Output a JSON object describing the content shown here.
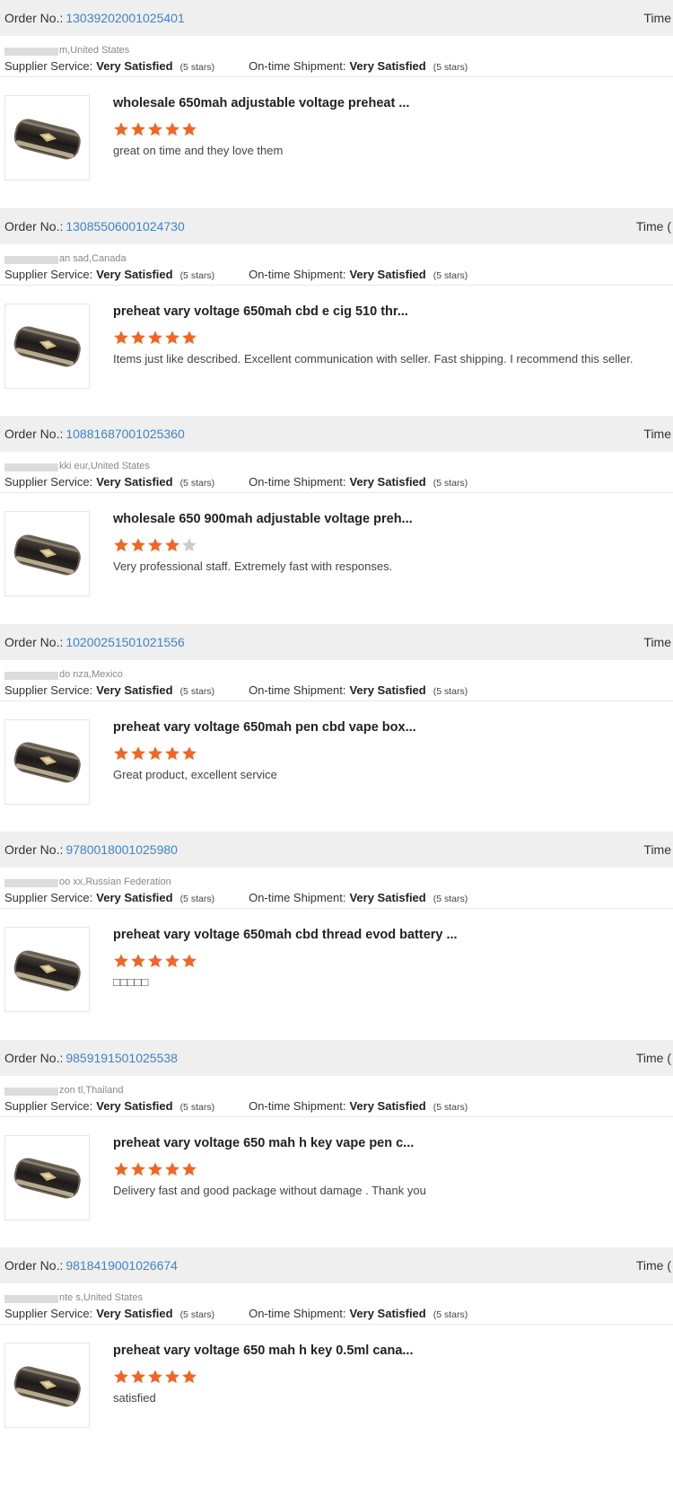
{
  "labels": {
    "order_no": "Order No.:",
    "time": "Time",
    "supplier_service": "Supplier Service:",
    "on_time_shipment": "On-time Shipment:"
  },
  "colors": {
    "accent_link": "#3d85c6",
    "star_filled": "#f26522",
    "star_empty": "#cccccc",
    "header_bg": "#efefef"
  },
  "orders": [
    {
      "order_no": "13039202001025401",
      "time": "Time",
      "buyer_location": "m,United States",
      "supplier_service": "Very Satisfied",
      "supplier_stars": "(5 stars)",
      "shipment": "Very Satisfied",
      "shipment_stars": "(5 stars)",
      "product_title": "wholesale 650mah adjustable voltage preheat ...",
      "rating": 5,
      "comment": "great on time and they love them"
    },
    {
      "order_no": "13085506001024730",
      "time": "Time (",
      "buyer_location": "an  sad,Canada",
      "supplier_service": "Very Satisfied",
      "supplier_stars": "(5 stars)",
      "shipment": "Very Satisfied",
      "shipment_stars": "(5 stars)",
      "product_title": "preheat vary voltage 650mah cbd e cig 510 thr...",
      "rating": 5,
      "comment": "Items just like described. Excellent communication with seller. Fast shipping. I recommend this seller."
    },
    {
      "order_no": "10881687001025360",
      "time": "Time",
      "buyer_location": "kki eur,United States",
      "supplier_service": "Very Satisfied",
      "supplier_stars": "(5 stars)",
      "shipment": "Very Satisfied",
      "shipment_stars": "(5 stars)",
      "product_title": "wholesale 650 900mah adjustable voltage preh...",
      "rating": 4,
      "comment": "Very professional staff. Extremely fast with responses."
    },
    {
      "order_no": "10200251501021556",
      "time": "Time",
      "buyer_location": "do nza,Mexico",
      "supplier_service": "Very Satisfied",
      "supplier_stars": "(5 stars)",
      "shipment": "Very Satisfied",
      "shipment_stars": "(5 stars)",
      "product_title": "preheat vary voltage 650mah pen cbd vape box...",
      "rating": 5,
      "comment": "Great product, excellent service"
    },
    {
      "order_no": "9780018001025980",
      "time": "Time",
      "buyer_location": "oo xx,Russian Federation",
      "supplier_service": "Very Satisfied",
      "supplier_stars": "(5 stars)",
      "shipment": "Very Satisfied",
      "shipment_stars": "(5 stars)",
      "product_title": "preheat vary voltage 650mah cbd thread evod battery ...",
      "rating": 5,
      "comment": "□□□□□"
    },
    {
      "order_no": "9859191501025538",
      "time": "Time (",
      "buyer_location": "zon tl,Thailand",
      "supplier_service": "Very Satisfied",
      "supplier_stars": "(5 stars)",
      "shipment": "Very Satisfied",
      "shipment_stars": "(5 stars)",
      "product_title": "preheat vary voltage 650 mah h key vape pen c...",
      "rating": 5,
      "comment": "Delivery fast and good package without damage . Thank you"
    },
    {
      "order_no": "9818419001026674",
      "time": "Time (",
      "buyer_location": "nte s,United States",
      "supplier_service": "Very Satisfied",
      "supplier_stars": "(5 stars)",
      "shipment": "Very Satisfied",
      "shipment_stars": "(5 stars)",
      "product_title": "preheat vary voltage 650 mah h key 0.5ml cana...",
      "rating": 5,
      "comment": "satisfied"
    }
  ]
}
